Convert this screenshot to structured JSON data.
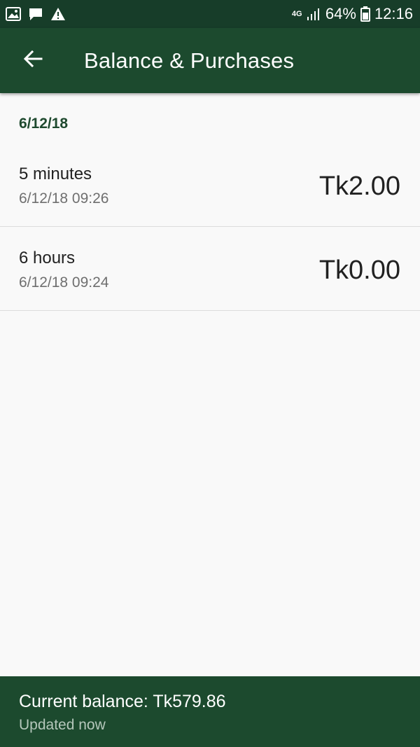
{
  "status_bar": {
    "icons_left": [
      "image-icon",
      "message-icon",
      "warning-icon"
    ],
    "network_type": "4G",
    "battery": "64%",
    "time": "12:16"
  },
  "app_bar": {
    "back_icon": "arrow-left-icon",
    "title": "Balance & Purchases"
  },
  "purchases": {
    "date_header": "6/12/18",
    "items": [
      {
        "name": "5 minutes",
        "timestamp": "6/12/18 09:26",
        "amount": "Tk2.00"
      },
      {
        "name": "6 hours",
        "timestamp": "6/12/18 09:24",
        "amount": "Tk0.00"
      }
    ]
  },
  "balance": {
    "current": "Current balance: Tk579.86",
    "updated": "Updated now"
  },
  "colors": {
    "status_bar": "#173d29",
    "app_bar": "#1c4a2e",
    "background": "#f9f9f9",
    "accent_text": "#1f4a2f"
  }
}
